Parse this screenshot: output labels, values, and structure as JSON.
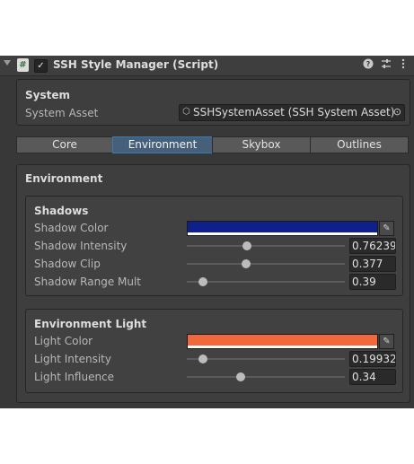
{
  "header": {
    "title": "SSH Style Manager (Script)",
    "enabled": true,
    "icons": [
      "foldout-arrow-icon",
      "script-icon",
      "help-icon",
      "presets-icon",
      "more-icon"
    ]
  },
  "system": {
    "title": "System",
    "asset_label": "System Asset",
    "asset_value": "SSHSystemAsset (SSH System Asset)"
  },
  "tabs": [
    {
      "label": "Core",
      "active": false
    },
    {
      "label": "Environment",
      "active": true
    },
    {
      "label": "Skybox",
      "active": false
    },
    {
      "label": "Outlines",
      "active": false
    }
  ],
  "environment": {
    "title": "Environment",
    "shadows": {
      "title": "Shadows",
      "color_label": "Shadow Color",
      "color": "#0f1f8c",
      "intensity_label": "Shadow Intensity",
      "intensity_value": "0.76239",
      "intensity_fraction": 0.38,
      "clip_label": "Shadow Clip",
      "clip_value": "0.377",
      "clip_fraction": 0.377,
      "range_label": "Shadow Range Mult",
      "range_value": "0.39",
      "range_fraction": 0.1
    },
    "light": {
      "title": "Environment Light",
      "color_label": "Light Color",
      "color": "#f2683d",
      "intensity_label": "Light Intensity",
      "intensity_value": "0.19932",
      "intensity_fraction": 0.1,
      "influence_label": "Light Influence",
      "influence_value": "0.34",
      "influence_fraction": 0.34
    }
  }
}
